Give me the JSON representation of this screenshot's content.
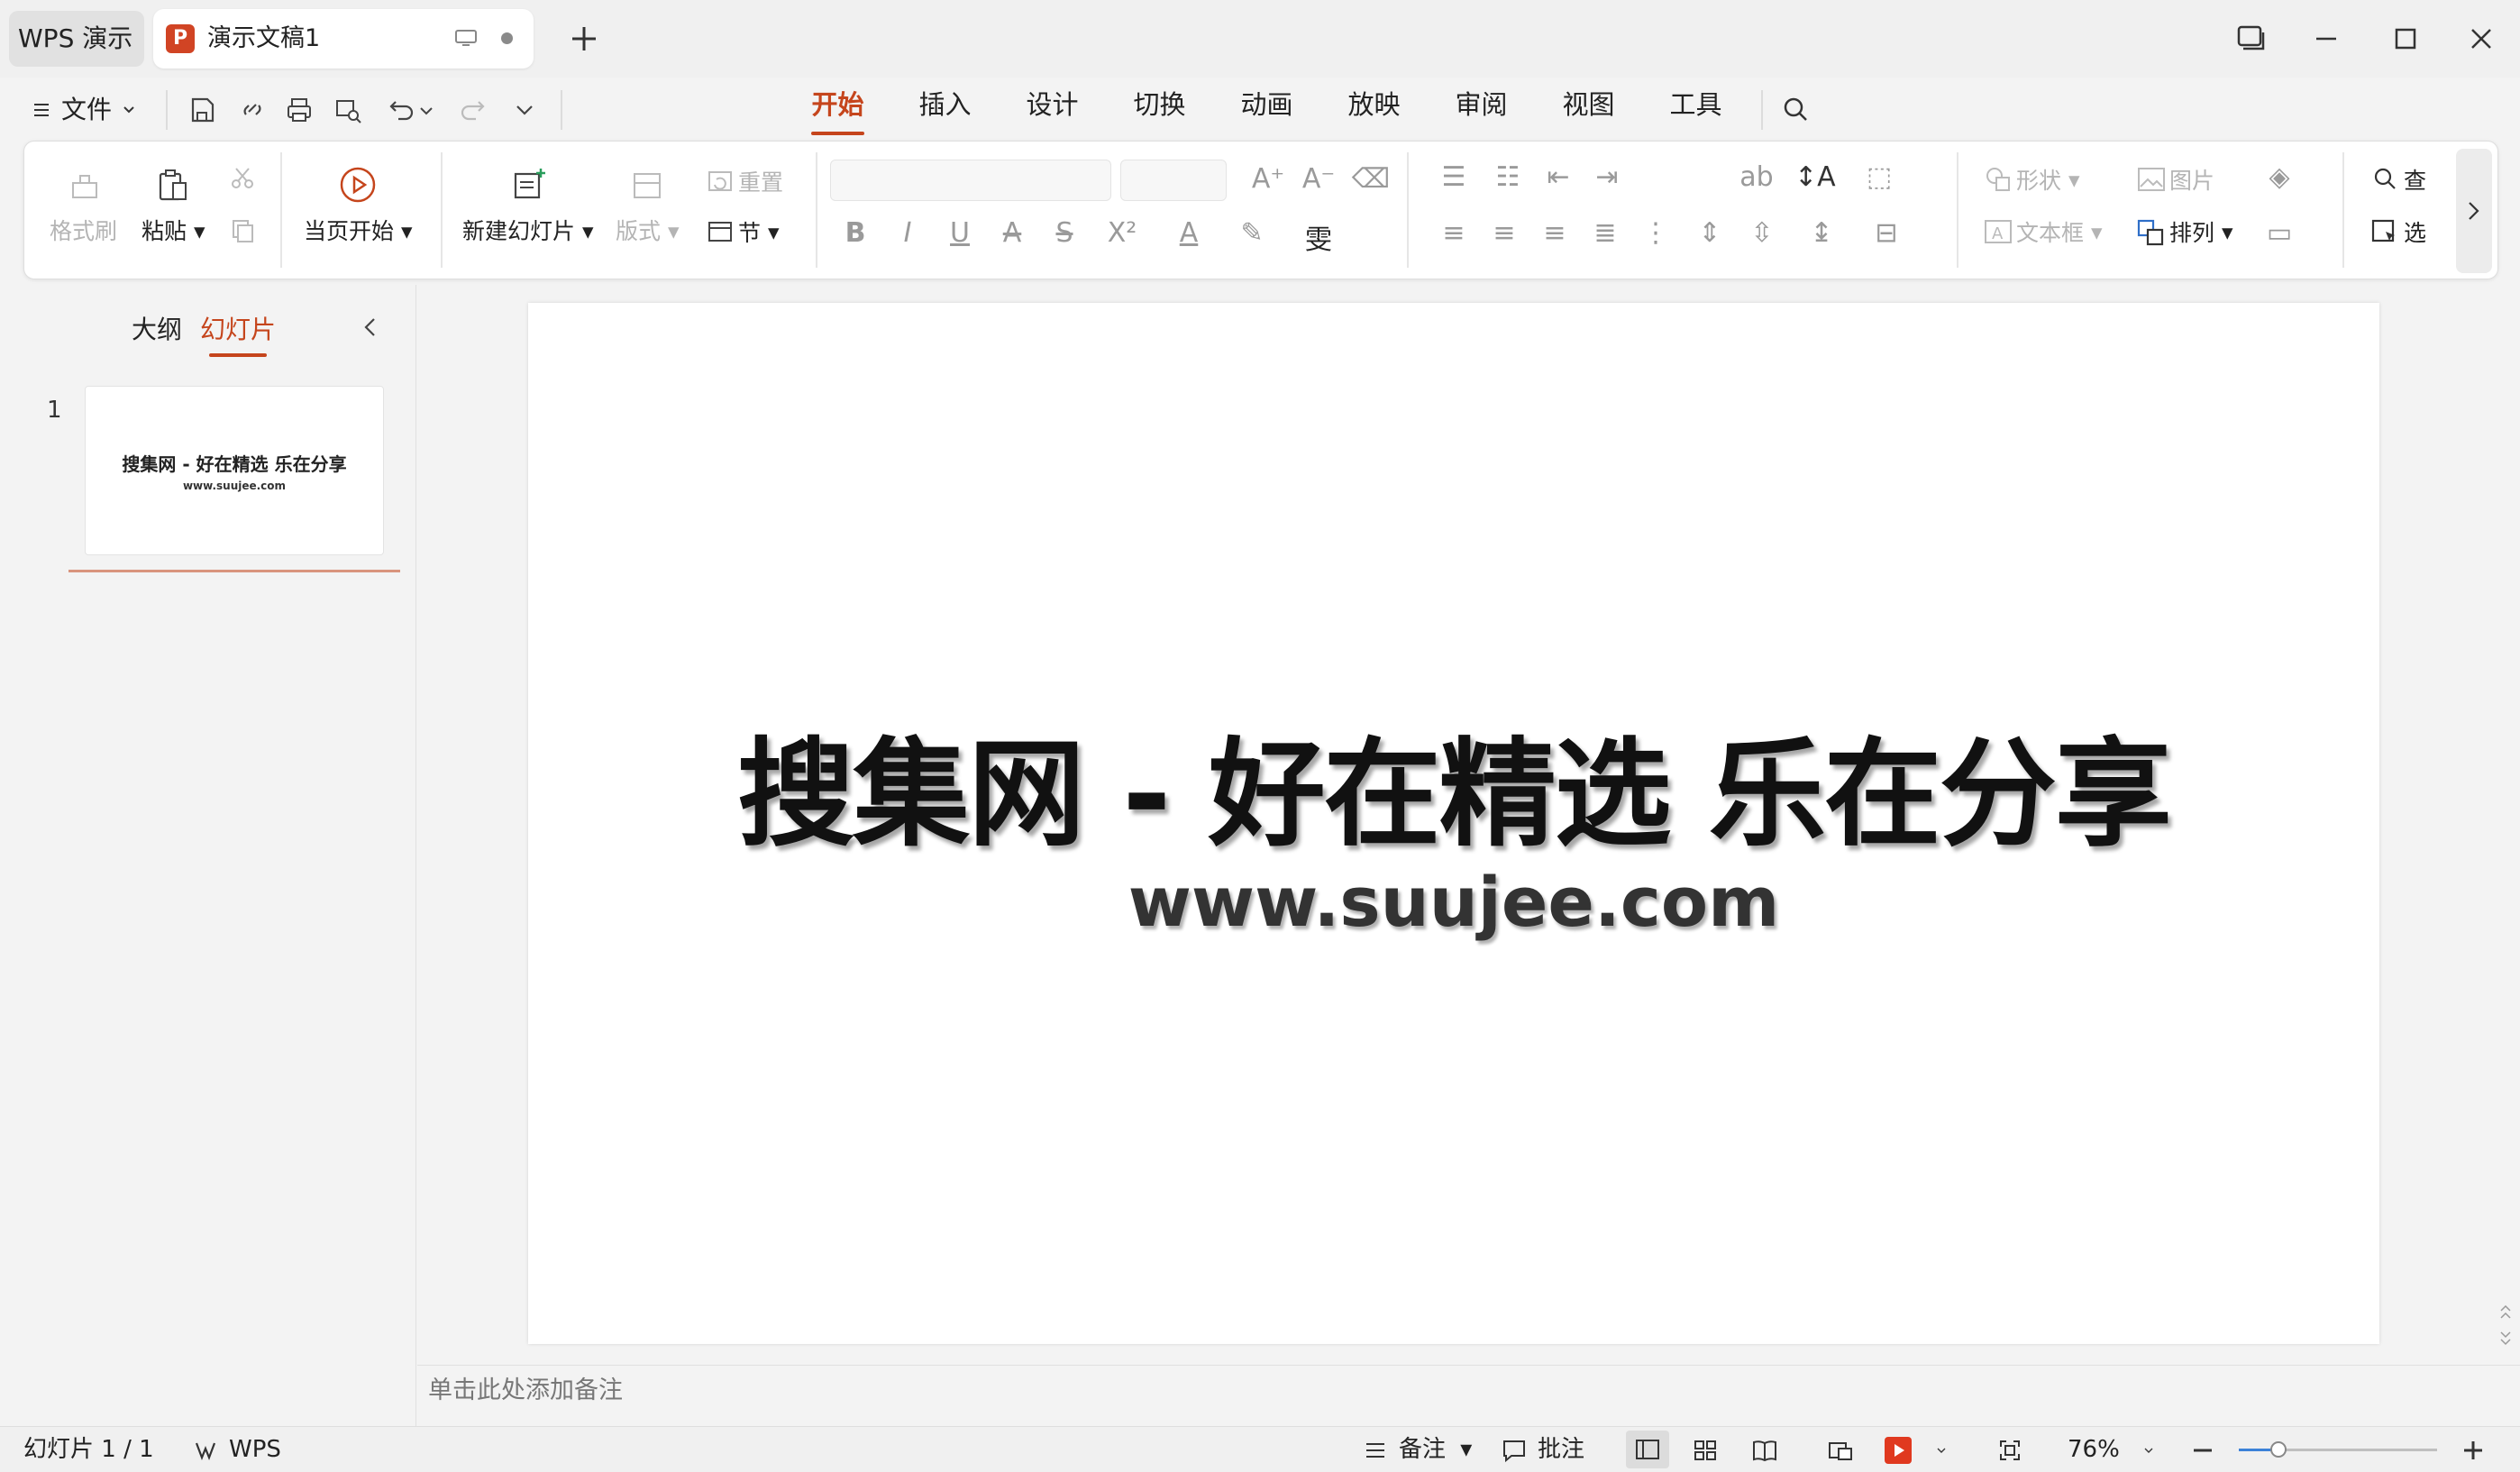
{
  "titlebar": {
    "app_tab": "WPS 演示",
    "doc_tab": "演示文稿1",
    "doc_icon_letter": "P"
  },
  "menu": {
    "file_label": "文件",
    "tabs": [
      {
        "label": "开始",
        "active": true
      },
      {
        "label": "插入"
      },
      {
        "label": "设计"
      },
      {
        "label": "切换"
      },
      {
        "label": "动画"
      },
      {
        "label": "放映"
      },
      {
        "label": "审阅"
      },
      {
        "label": "视图"
      },
      {
        "label": "工具"
      }
    ]
  },
  "ribbon": {
    "format_painter": "格式刷",
    "paste": "粘贴",
    "play_from_current": "当页开始",
    "new_slide": "新建幻灯片",
    "layout": "版式",
    "reset": "重置",
    "section": "节",
    "shape": "形状",
    "picture": "图片",
    "textbox": "文本框",
    "arrange": "排列",
    "find": "查",
    "select": "选"
  },
  "left_panel": {
    "tab_outline": "大纲",
    "tab_slides": "幻灯片",
    "slide_number": "1",
    "thumb_title": "搜集网 - 好在精选 乐在分享",
    "thumb_url": "www.suujee.com"
  },
  "slide": {
    "title": "搜集网 - 好在精选 乐在分享",
    "url": "www.suujee.com"
  },
  "notes": {
    "placeholder": "单击此处添加备注"
  },
  "status": {
    "slide_count": "幻灯片 1 / 1",
    "wps_label": "WPS",
    "notes_label": "备注",
    "comments_label": "批注",
    "zoom": "76%",
    "zoom_fraction": 0.2
  },
  "colors": {
    "accent": "#c5451c",
    "play_button": "#e0391f"
  }
}
